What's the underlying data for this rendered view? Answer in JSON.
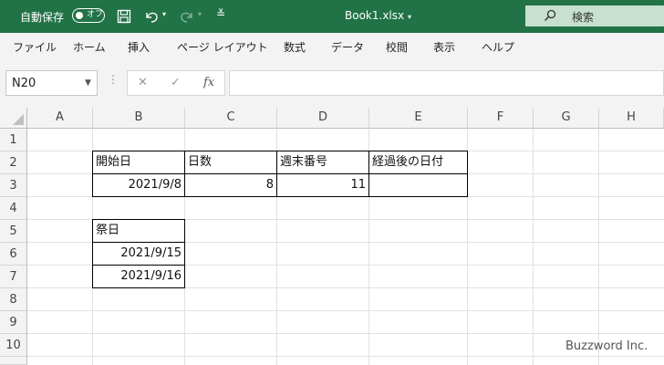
{
  "titlebar": {
    "autosave_label": "自動保存",
    "autosave_state": "オフ",
    "doc_title": "Book1.xlsx",
    "search_placeholder": "検索",
    "accent": "#217346"
  },
  "menu": [
    "ファイル",
    "ホーム",
    "挿入",
    "ページ レイアウト",
    "数式",
    "データ",
    "校閲",
    "表示",
    "ヘルプ"
  ],
  "formula_bar": {
    "name_box": "N20",
    "fx": "fx",
    "formula": ""
  },
  "sheet": {
    "columns": [
      "A",
      "B",
      "C",
      "D",
      "E",
      "F",
      "G",
      "H"
    ],
    "rows": [
      "1",
      "2",
      "3",
      "4",
      "5",
      "6",
      "7",
      "8",
      "9",
      "10"
    ],
    "cells": {
      "B2": "開始日",
      "C2": "日数",
      "D2": "週末番号",
      "E2": "経過後の日付",
      "B3": "2021/9/8",
      "C3": "8",
      "D3": "11",
      "E3": "",
      "B5": "祭日",
      "B6": "2021/9/15",
      "B7": "2021/9/16"
    }
  },
  "watermark": "Buzzword Inc."
}
